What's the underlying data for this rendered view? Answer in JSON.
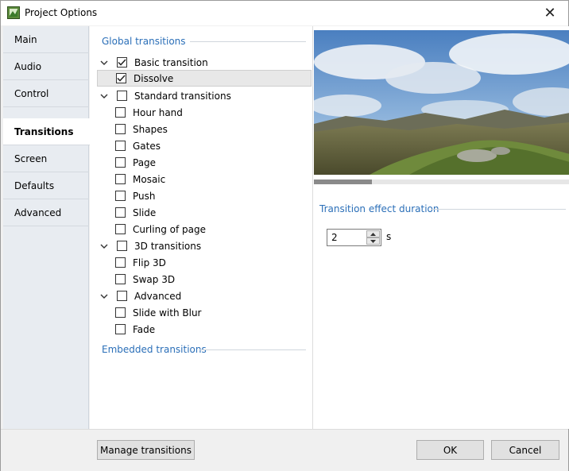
{
  "window": {
    "title": "Project Options",
    "close_label": "✕"
  },
  "sidebar": {
    "items": [
      {
        "label": "Main"
      },
      {
        "label": "Audio"
      },
      {
        "label": "Control"
      },
      {
        "label": "Transitions",
        "active": true
      },
      {
        "label": "Screen"
      },
      {
        "label": "Defaults"
      },
      {
        "label": "Advanced"
      }
    ]
  },
  "content": {
    "global_header": "Global transitions",
    "embedded_header": "Embedded transitions",
    "tree": [
      {
        "label": "Basic transition",
        "level": 0,
        "expanded": true,
        "checked": true
      },
      {
        "label": "Dissolve",
        "level": 1,
        "checked": true,
        "selected": true
      },
      {
        "label": "Standard transitions",
        "level": 0,
        "expanded": true,
        "checked": false
      },
      {
        "label": "Hour hand",
        "level": 1,
        "checked": false
      },
      {
        "label": "Shapes",
        "level": 1,
        "checked": false
      },
      {
        "label": "Gates",
        "level": 1,
        "checked": false
      },
      {
        "label": "Page",
        "level": 1,
        "checked": false
      },
      {
        "label": "Mosaic",
        "level": 1,
        "checked": false
      },
      {
        "label": "Push",
        "level": 1,
        "checked": false
      },
      {
        "label": "Slide",
        "level": 1,
        "checked": false
      },
      {
        "label": "Curling of page",
        "level": 1,
        "checked": false
      },
      {
        "label": "3D transitions",
        "level": 0,
        "expanded": true,
        "checked": false
      },
      {
        "label": "Flip 3D",
        "level": 1,
        "checked": false
      },
      {
        "label": "Swap 3D",
        "level": 1,
        "checked": false
      },
      {
        "label": "Advanced",
        "level": 0,
        "expanded": true,
        "checked": false
      },
      {
        "label": "Slide with Blur",
        "level": 1,
        "checked": false
      },
      {
        "label": "Fade",
        "level": 1,
        "checked": false
      }
    ]
  },
  "right": {
    "duration_header": "Transition effect duration",
    "duration_value": "2",
    "duration_unit": "s"
  },
  "footer": {
    "manage_label": "Manage transitions",
    "ok_label": "OK",
    "cancel_label": "Cancel"
  },
  "colors": {
    "accent": "#2b6fb8",
    "sidebar_bg": "#e8ecf1",
    "window_bg": "#f0f0f0"
  }
}
